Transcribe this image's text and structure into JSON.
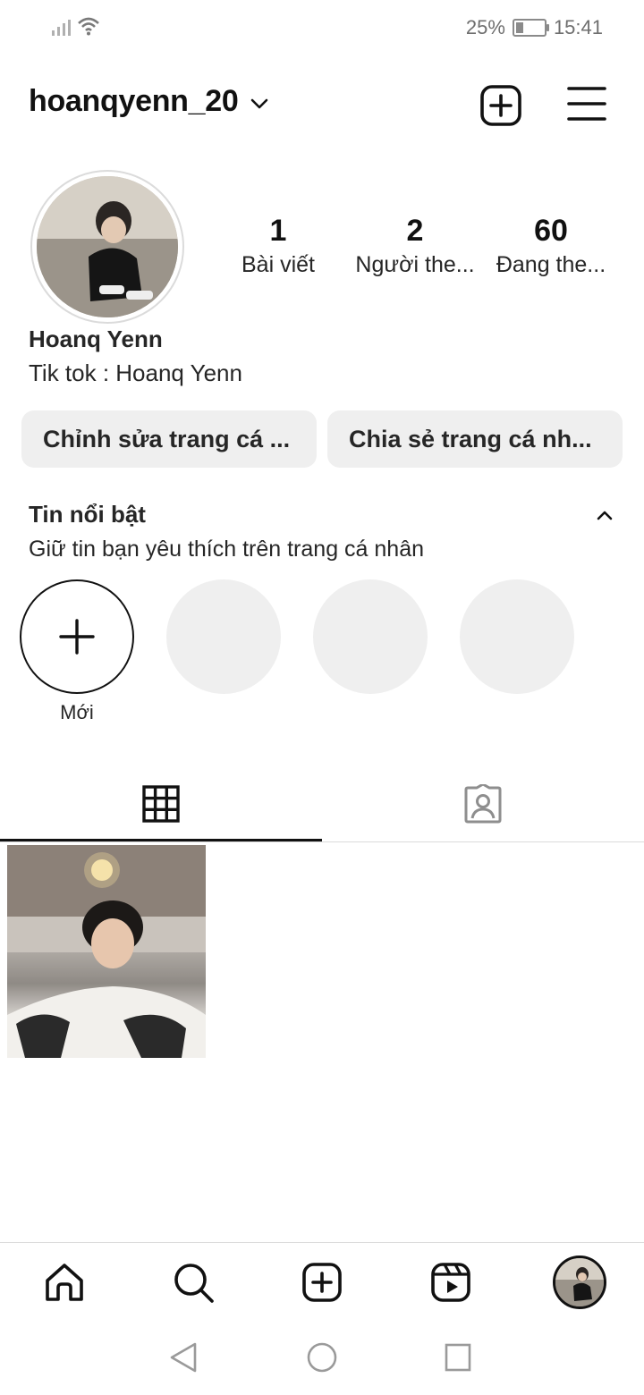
{
  "status_bar": {
    "battery_percent": "25%",
    "time": "15:41"
  },
  "header": {
    "username": "hoanqyenn_20"
  },
  "profile": {
    "full_name": "Hoanq Yenn",
    "bio": "Tik tok : Hoanq Yenn",
    "stats": [
      {
        "value": "1",
        "label": "Bài viết"
      },
      {
        "value": "2",
        "label": "Người the..."
      },
      {
        "value": "60",
        "label": "Đang the..."
      }
    ]
  },
  "buttons": {
    "edit_profile": "Chỉnh sửa trang cá ...",
    "share_profile": "Chia sẻ trang cá nh..."
  },
  "highlights": {
    "title": "Tin nổi bật",
    "subtitle": "Giữ tin bạn yêu thích trên trang cá nhân",
    "new_label": "Mới"
  },
  "tabs": [
    {
      "name": "posts-grid",
      "icon": "grid-icon",
      "active": true
    },
    {
      "name": "tagged",
      "icon": "tagged-person-icon",
      "active": false
    }
  ],
  "bottom_nav": [
    "home-icon",
    "search-icon",
    "create-icon",
    "reels-icon",
    "profile-avatar"
  ],
  "colors": {
    "text": "#262626",
    "button_bg": "#efefef",
    "divider": "#dbdbdb",
    "active": "#111111",
    "muted": "#8e8e8e"
  }
}
